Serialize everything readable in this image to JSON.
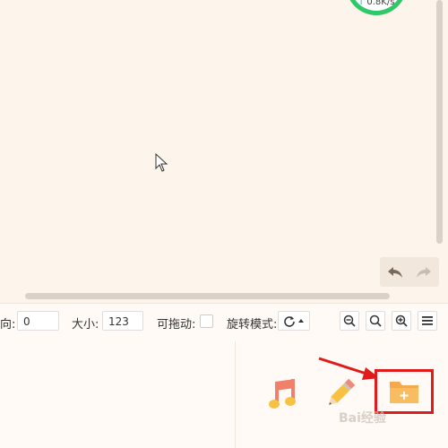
{
  "speed": {
    "value": "0.8K/s",
    "arrow": "↑"
  },
  "toolbar": {
    "direction_label": "向:",
    "direction_value": "0",
    "size_label": "大小:",
    "size_value": "123",
    "draggable_label": "可拖动:",
    "rotate_label": "旋转模式:"
  },
  "icons": {
    "music": "music-note-icon",
    "pencil": "pencil-icon",
    "folder": "folder-add-icon",
    "undo": "undo-icon",
    "redo": "redo-icon",
    "zoom_out": "zoom-out-icon",
    "zoom_reset": "zoom-reset-icon",
    "zoom_in": "zoom-in-icon",
    "menu": "menu-icon",
    "rotate": "rotate-icon"
  },
  "watermark": "Bai经验",
  "colors": {
    "highlight": "#e01b1b",
    "gauge": "#2ec866",
    "folder": "#f6a94a"
  }
}
